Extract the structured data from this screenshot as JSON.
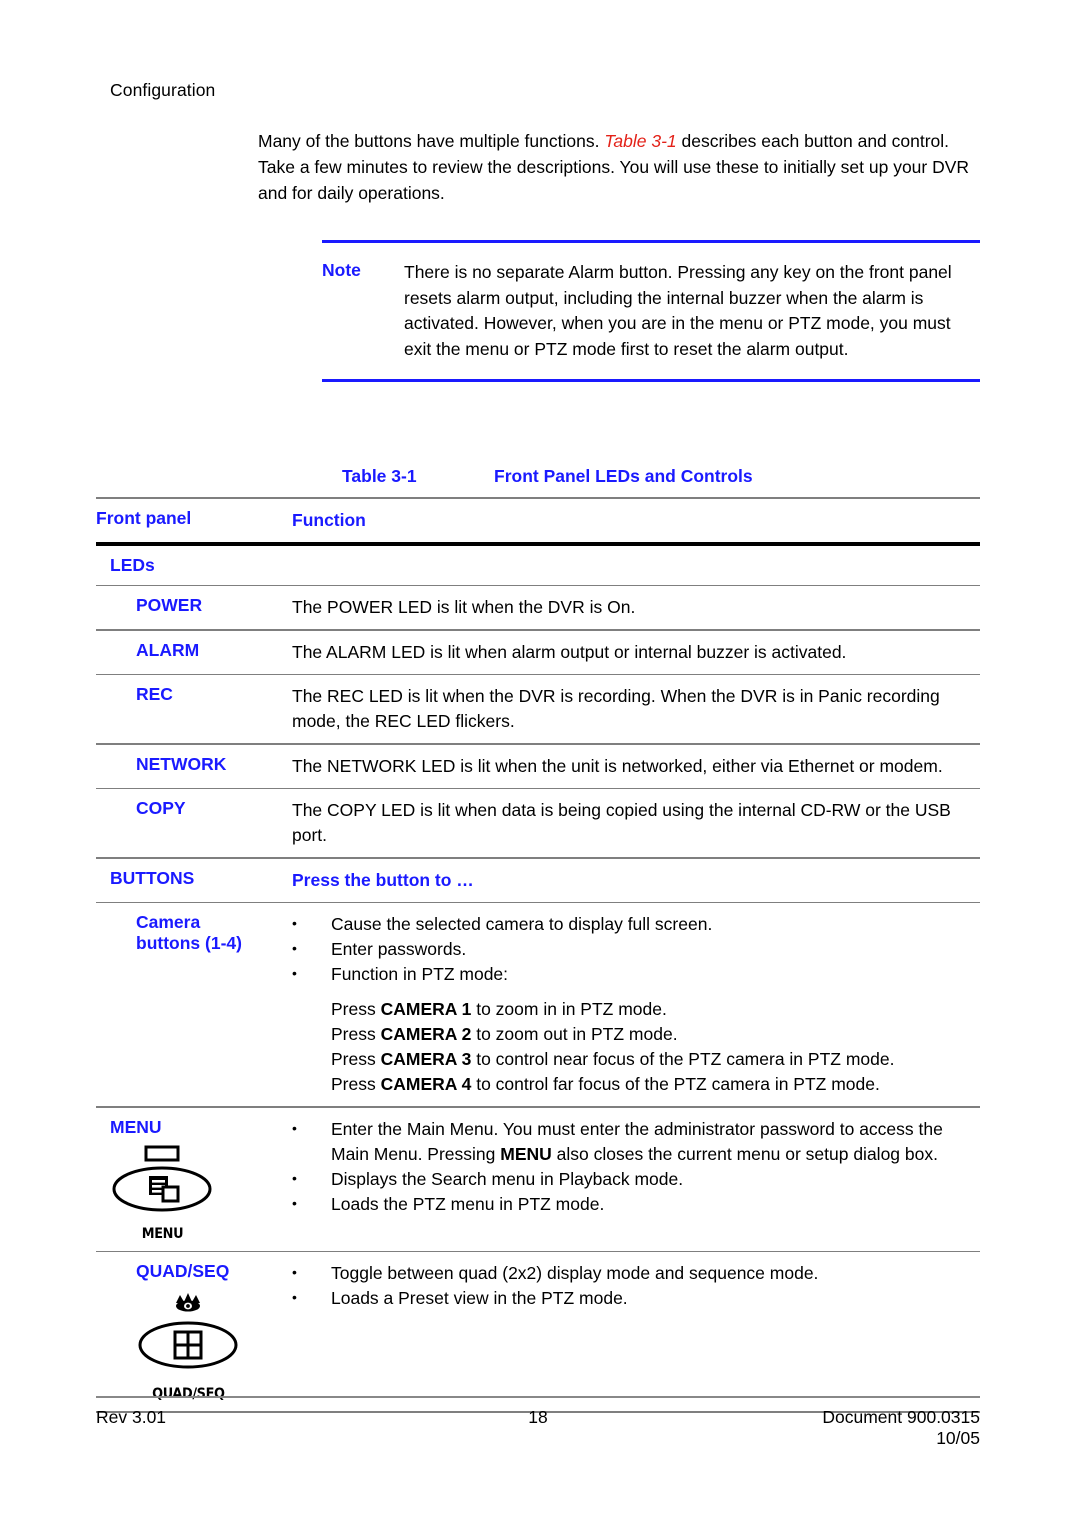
{
  "running_head": "Configuration",
  "intro": {
    "before": "Many of the buttons have multiple functions. ",
    "xref": "Table 3-1",
    "after": " describes each button and control. Take a few minutes to review the descriptions. You will use these to initially set up your DVR and for daily operations."
  },
  "note": {
    "label": "Note",
    "text": "There is no separate Alarm button. Pressing any key on the front panel resets alarm output, including the internal buzzer when the alarm is activated. However, when you are in the menu or PTZ mode, you must exit the menu or PTZ mode first to reset the alarm output."
  },
  "table": {
    "caption_number": "Table 3-1",
    "caption_title": "Front Panel LEDs and Controls",
    "headers": {
      "left": "Front panel",
      "right": "Function"
    },
    "section_leds": "LEDs",
    "leds": [
      {
        "name": "POWER",
        "description": "The POWER LED is lit when the DVR is On."
      },
      {
        "name": "ALARM",
        "description": "The ALARM LED is lit when alarm output or internal buzzer is activated."
      },
      {
        "name": "REC",
        "description": "The REC LED is lit when the DVR is recording. When the DVR is in Panic recording mode, the REC LED flickers."
      },
      {
        "name": "NETWORK",
        "description": "The NETWORK LED is lit when the unit is networked, either via Ethernet or modem."
      },
      {
        "name": "COPY",
        "description": "The COPY LED is lit when data is being copied using the internal CD-RW or the USB port."
      }
    ],
    "section_buttons": "BUTTONS",
    "section_buttons_function": "Press the button to …",
    "camera": {
      "name_line1": "Camera",
      "name_line2": "buttons (1-4)",
      "bullets": [
        "Cause the selected camera to display full screen.",
        "Enter passwords.",
        "Function in PTZ mode:"
      ],
      "sub_lines": [
        {
          "pre": "Press ",
          "key": "CAMERA 1",
          "post": " to zoom in in PTZ mode."
        },
        {
          "pre": "Press ",
          "key": "CAMERA 2",
          "post": " to zoom out in PTZ mode."
        },
        {
          "pre": "Press ",
          "key": "CAMERA 3",
          "post": " to control near focus of the PTZ camera in PTZ mode."
        },
        {
          "pre": "Press ",
          "key": "CAMERA 4",
          "post": " to control far focus of the PTZ camera in PTZ mode."
        }
      ]
    },
    "menu": {
      "name": "MENU",
      "glyph_caption": "MENU",
      "bullet1_pre": "Enter the Main Menu. You must enter the administrator password to access the Main Menu. Pressing ",
      "bullet1_key": "MENU",
      "bullet1_post": " also closes the current menu or setup dialog box.",
      "bullets": [
        "Displays the Search menu in Playback mode.",
        "Loads the PTZ menu in PTZ mode."
      ]
    },
    "quadseq": {
      "name": "QUAD/SEQ",
      "glyph_caption": "QUAD/SEQ",
      "bullets": [
        "Toggle between quad (2x2) display mode and sequence mode.",
        "Loads a Preset view in the PTZ mode."
      ]
    }
  },
  "footer": {
    "left": "Rev 3.01",
    "center": "18",
    "right_line1": "Document 900.0315",
    "right_line2": "10/05"
  },
  "colors": {
    "heading_blue": "#1a1aff",
    "xref_red": "#e32118",
    "rule_gray": "#7f7f7f",
    "rule_black": "#000000"
  }
}
